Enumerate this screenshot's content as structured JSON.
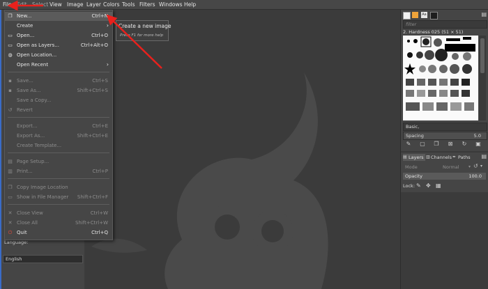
{
  "menubar": {
    "items": [
      "File",
      "Edit",
      "Select",
      "View",
      "Image",
      "Layer",
      "Colors",
      "Tools",
      "Filters",
      "Windows",
      "Help"
    ]
  },
  "file_menu": {
    "items": [
      {
        "label": "New...",
        "shortcut": "Ctrl+N",
        "icon": "new-image-icon",
        "enabled": true
      },
      {
        "label": "Create",
        "shortcut": "",
        "icon": "",
        "enabled": true,
        "submenu": true
      },
      {
        "label": "Open...",
        "shortcut": "Ctrl+O",
        "icon": "open-folder-icon",
        "enabled": true
      },
      {
        "label": "Open as Layers...",
        "shortcut": "Ctrl+Alt+O",
        "icon": "open-layers-icon",
        "enabled": true
      },
      {
        "label": "Open Location...",
        "shortcut": "",
        "icon": "globe-icon",
        "enabled": true
      },
      {
        "label": "Open Recent",
        "shortcut": "",
        "icon": "",
        "enabled": true,
        "submenu": true
      },
      {
        "label": "Save...",
        "shortcut": "Ctrl+S",
        "icon": "save-icon",
        "enabled": false
      },
      {
        "label": "Save As...",
        "shortcut": "Shift+Ctrl+S",
        "icon": "save-as-icon",
        "enabled": false
      },
      {
        "label": "Save a Copy...",
        "shortcut": "",
        "icon": "",
        "enabled": false
      },
      {
        "label": "Revert",
        "shortcut": "",
        "icon": "revert-icon",
        "enabled": false
      },
      {
        "label": "Export...",
        "shortcut": "Ctrl+E",
        "icon": "",
        "enabled": false
      },
      {
        "label": "Export As...",
        "shortcut": "Shift+Ctrl+E",
        "icon": "",
        "enabled": false
      },
      {
        "label": "Create Template...",
        "shortcut": "",
        "icon": "",
        "enabled": false
      },
      {
        "label": "Page Setup...",
        "shortcut": "",
        "icon": "page-setup-icon",
        "enabled": false
      },
      {
        "label": "Print...",
        "shortcut": "Ctrl+P",
        "icon": "print-icon",
        "enabled": false
      },
      {
        "label": "Copy Image Location",
        "shortcut": "",
        "icon": "copy-icon",
        "enabled": false
      },
      {
        "label": "Show in File Manager",
        "shortcut": "Shift+Ctrl+F",
        "icon": "file-manager-icon",
        "enabled": false
      },
      {
        "label": "Close View",
        "shortcut": "Ctrl+W",
        "icon": "close-icon",
        "enabled": false
      },
      {
        "label": "Close All",
        "shortcut": "Shift+Ctrl+W",
        "icon": "close-all-icon",
        "enabled": false
      },
      {
        "label": "Quit",
        "shortcut": "Ctrl+Q",
        "icon": "quit-icon",
        "enabled": true
      }
    ]
  },
  "tooltip": {
    "title": "Create a new image",
    "hint": "Press F1 for more help"
  },
  "left_panel": {
    "language_label": "Language:",
    "language_value": "English"
  },
  "brushes": {
    "filter_placeholder": "filter",
    "selected_brush": "2. Hardness 025 (51 × 51)",
    "preset": "Basic,",
    "spacing_label": "Spacing",
    "spacing_value": "5.0"
  },
  "layers": {
    "tabs": [
      "Layers",
      "Channels",
      "Paths"
    ],
    "mode_label": "Mode",
    "mode_value": "Normal",
    "opacity_label": "Opacity",
    "opacity_value": "100.0",
    "lock_label": "Lock:"
  },
  "colors": {
    "accent_red": "#e8211d",
    "menu_bg": "#464646",
    "highlight_bg": "#5b5b5b"
  }
}
